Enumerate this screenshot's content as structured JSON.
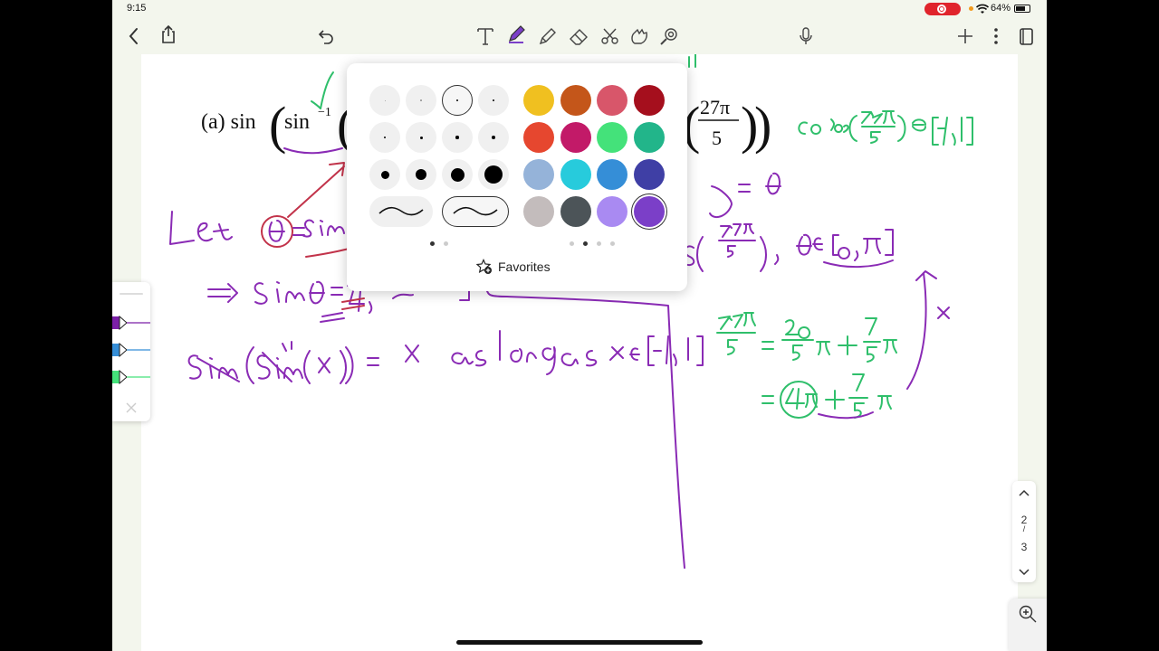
{
  "status_bar": {
    "time": "9:15",
    "battery": "64%"
  },
  "colors": {
    "accent_purple": "#7b3fc8",
    "ink_purple": "#8a2bb5",
    "ink_green": "#2fbf6b",
    "ink_red": "#c2334a",
    "toolbar_bg": "#f3f6ed"
  },
  "toolbar": {
    "left_icons": [
      "back-chevron-icon",
      "share-icon",
      "undo-icon"
    ],
    "tools": [
      "text-tool-icon",
      "pen-tool-icon",
      "highlighter-tool-icon",
      "eraser-tool-icon",
      "lasso-scissors-icon",
      "shapes-tool-icon",
      "laser-pointer-icon"
    ],
    "right_icons": [
      "microphone-icon",
      "add-icon",
      "more-icon",
      "pages-icon"
    ]
  },
  "popover": {
    "pen_sizes": [
      1,
      1.5,
      2,
      2,
      2.5,
      3,
      3.5,
      4,
      9,
      12,
      15,
      20
    ],
    "selected_size_index": 2,
    "stroke_styles": [
      "stroke-style-1",
      "stroke-style-2"
    ],
    "selected_stroke_index": 1,
    "colors": [
      [
        "#f0c020",
        "#c4561a",
        "#d8566a",
        "#a50f1d"
      ],
      [
        "#e6472f",
        "#c21a68",
        "#44e27a",
        "#22b58a"
      ],
      [
        "#95b3d9",
        "#27cbdc",
        "#358ed7",
        "#3f3fa5"
      ],
      [
        "#c3bcbc",
        "#4c5458",
        "#a98af2",
        "#7b3fc8"
      ]
    ],
    "selected_color": "#7b3fc8",
    "favorites_label": "Favorites",
    "left_page_dots": 2,
    "left_page_active": 0,
    "right_page_dots": 4,
    "right_page_active": 1
  },
  "math": {
    "problem_label": "(a) sin",
    "sin_inverse": "sin",
    "inverse_exp": "−1",
    "frac_num": "27π",
    "frac_den": "5"
  },
  "page_nav": {
    "current": "2",
    "total": "3"
  }
}
